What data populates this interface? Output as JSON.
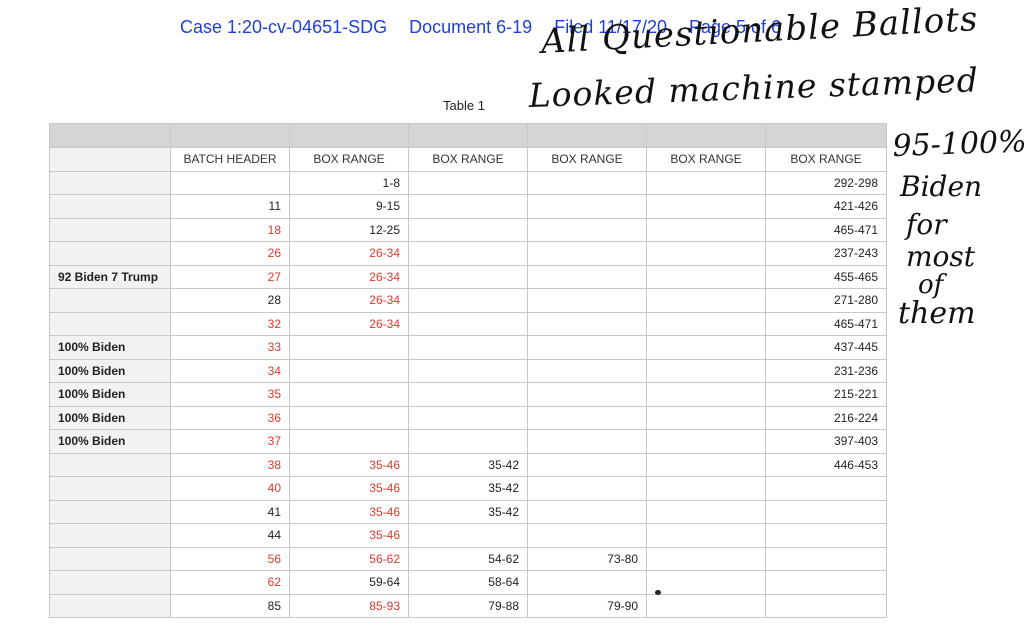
{
  "header": {
    "case": "Case 1:20-cv-04651-SDG",
    "document": "Document 6-19",
    "filed": "Filed 11/17/20",
    "page": "Page 5 of 6"
  },
  "caption": "Table 1",
  "handwriting": {
    "line1": "All Questionable Ballots",
    "line2": "Looked machine stamped",
    "side1": "95-100%",
    "side2": "Biden",
    "side3": "for",
    "side4": "most",
    "side5": "of",
    "side6": "them"
  },
  "table": {
    "headers": [
      "",
      "BATCH HEADER",
      "BOX RANGE",
      "BOX RANGE",
      "BOX RANGE",
      "BOX RANGE",
      "BOX RANGE"
    ],
    "rows": [
      [
        "",
        "",
        "1-8",
        "",
        "",
        "",
        "292-298"
      ],
      [
        "",
        "11",
        "9-15",
        "",
        "",
        "",
        "421-426"
      ],
      [
        "",
        "18",
        "12-25",
        "",
        "",
        "",
        "465-471"
      ],
      [
        "",
        "26",
        "26-34",
        "",
        "",
        "",
        "237-243"
      ],
      [
        "92 Biden 7 Trump",
        "27",
        "26-34",
        "",
        "",
        "",
        "455-465"
      ],
      [
        "",
        "28",
        "26-34",
        "",
        "",
        "",
        "271-280"
      ],
      [
        "",
        "32",
        "26-34",
        "",
        "",
        "",
        "465-471"
      ],
      [
        "100% Biden",
        "33",
        "",
        "",
        "",
        "",
        "437-445"
      ],
      [
        "100% Biden",
        "34",
        "",
        "",
        "",
        "",
        "231-236"
      ],
      [
        "100% Biden",
        "35",
        "",
        "",
        "",
        "",
        "215-221"
      ],
      [
        "100% Biden",
        "36",
        "",
        "",
        "",
        "",
        "216-224"
      ],
      [
        "100% Biden",
        "37",
        "",
        "",
        "",
        "",
        "397-403"
      ],
      [
        "",
        "38",
        "35-46",
        "35-42",
        "",
        "",
        "446-453"
      ],
      [
        "",
        "40",
        "35-46",
        "35-42",
        "",
        "",
        ""
      ],
      [
        "",
        "41",
        "35-46",
        "35-42",
        "",
        "",
        ""
      ],
      [
        "",
        "44",
        "35-46",
        "",
        "",
        "",
        ""
      ],
      [
        "",
        "56",
        "56-62",
        "54-62",
        "73-80",
        "",
        ""
      ],
      [
        "",
        "62",
        "59-64",
        "58-64",
        "",
        "",
        ""
      ],
      [
        "",
        "85",
        "85-93",
        "79-88",
        "79-90",
        "",
        ""
      ]
    ],
    "red_cells": [
      [
        2,
        1
      ],
      [
        3,
        1
      ],
      [
        3,
        2
      ],
      [
        4,
        1
      ],
      [
        4,
        2
      ],
      [
        5,
        2
      ],
      [
        6,
        1
      ],
      [
        6,
        2
      ],
      [
        7,
        1
      ],
      [
        8,
        1
      ],
      [
        9,
        1
      ],
      [
        10,
        1
      ],
      [
        11,
        1
      ],
      [
        12,
        1
      ],
      [
        12,
        2
      ],
      [
        13,
        1
      ],
      [
        13,
        2
      ],
      [
        14,
        2
      ],
      [
        15,
        2
      ],
      [
        16,
        1
      ],
      [
        16,
        2
      ],
      [
        17,
        1
      ],
      [
        18,
        2
      ]
    ],
    "colors": {
      "red": "#d83a2c",
      "gray_band": "#d5d5d5",
      "header_blue": "#1f3fd6"
    }
  }
}
